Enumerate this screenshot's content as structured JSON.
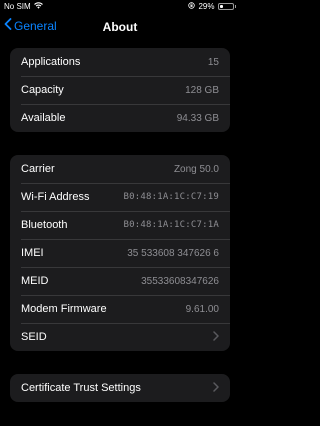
{
  "status_bar": {
    "carrier": "No SIM",
    "battery_text": "29%",
    "battery_level": 0.29
  },
  "nav": {
    "back_label": "General",
    "title": "About"
  },
  "group1": [
    {
      "label": "Applications",
      "value": "15"
    },
    {
      "label": "Capacity",
      "value": "128 GB"
    },
    {
      "label": "Available",
      "value": "94.33 GB"
    }
  ],
  "group2": [
    {
      "label": "Carrier",
      "value": "Zong 50.0"
    },
    {
      "label": "Wi-Fi Address",
      "value": "B0:48:1A:1C:C7:19"
    },
    {
      "label": "Bluetooth",
      "value": "B0:48:1A:1C:C7:1A"
    },
    {
      "label": "IMEI",
      "value": "35 533608 347626 6"
    },
    {
      "label": "MEID",
      "value": "35533608347626"
    },
    {
      "label": "Modem Firmware",
      "value": "9.61.00"
    },
    {
      "label": "SEID",
      "value": ""
    }
  ],
  "group3": [
    {
      "label": "Certificate Trust Settings",
      "value": ""
    }
  ]
}
